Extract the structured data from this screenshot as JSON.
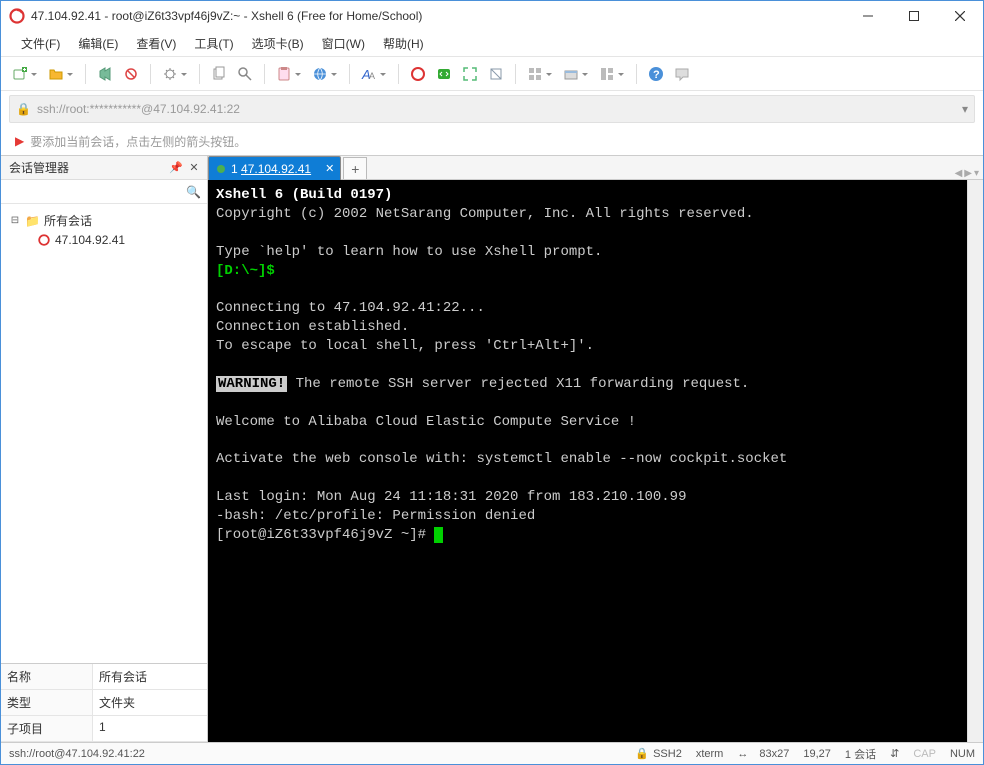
{
  "window": {
    "title": "47.104.92.41 - root@iZ6t33vpf46j9vZ:~ - Xshell 6 (Free for Home/School)"
  },
  "menu": {
    "items": [
      "文件(F)",
      "编辑(E)",
      "查看(V)",
      "工具(T)",
      "选项卡(B)",
      "窗口(W)",
      "帮助(H)"
    ]
  },
  "address": {
    "text": "ssh://root:***********@47.104.92.41:22"
  },
  "info": {
    "hint": "要添加当前会话，点击左侧的箭头按钮。"
  },
  "session_panel": {
    "title": "会话管理器",
    "search_placeholder": "",
    "root": "所有会话",
    "child": "47.104.92.41",
    "props": [
      {
        "key": "名称",
        "val": "所有会话"
      },
      {
        "key": "类型",
        "val": "文件夹"
      },
      {
        "key": "子项目",
        "val": "1"
      }
    ]
  },
  "tabs": {
    "active": {
      "index": "1",
      "label": "47.104.92.41"
    },
    "add": "+"
  },
  "terminal": {
    "header": "Xshell 6 (Build 0197)",
    "copyright": "Copyright (c) 2002 NetSarang Computer, Inc. All rights reserved.",
    "help": "Type `help' to learn how to use Xshell prompt.",
    "prompt1": "[D:\\~]$",
    "connecting": "Connecting to 47.104.92.41:22...",
    "connected": "Connection established.",
    "escape": "To escape to local shell, press 'Ctrl+Alt+]'.",
    "warn_label": "WARNING!",
    "warn_text": " The remote SSH server rejected X11 forwarding request.",
    "welcome": "Welcome to Alibaba Cloud Elastic Compute Service !",
    "activate": "Activate the web console with: systemctl enable --now cockpit.socket",
    "last_login": "Last login: Mon Aug 24 11:18:31 2020 from 183.210.100.99",
    "bash_err": "-bash: /etc/profile: Permission denied",
    "prompt2": "[root@iZ6t33vpf46j9vZ ~]# "
  },
  "status": {
    "left": "ssh://root@47.104.92.41:22",
    "proto": "SSH2",
    "term": "xterm",
    "size": "83x27",
    "pos": "19,27",
    "sess": "1 会话",
    "cap": "CAP",
    "num": "NUM"
  }
}
